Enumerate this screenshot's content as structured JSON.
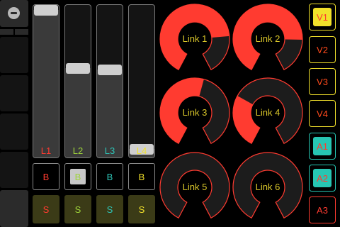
{
  "theme": {
    "red": "#ff3b30",
    "green": "#9ed33a",
    "cyan": "#2ec4b6",
    "yellow": "#f2e12b",
    "orange": "#ff4a1c",
    "teal": "#27c6b3"
  },
  "nav": {
    "icon": "toggle-knob-icon"
  },
  "faders": [
    {
      "label": "L1",
      "color": "#ff3b30",
      "level": 1.0
    },
    {
      "label": "L2",
      "color": "#9ed33a",
      "level": 0.59
    },
    {
      "label": "L3",
      "color": "#2ec4b6",
      "level": 0.58
    },
    {
      "label": "L4",
      "color": "#f2e12b",
      "level": 0.02
    }
  ],
  "bbuttons": [
    {
      "label": "B",
      "color": "#ff3b30",
      "active": false
    },
    {
      "label": "B",
      "color": "#9ed33a",
      "active": true
    },
    {
      "label": "B",
      "color": "#2ec4b6",
      "active": false
    },
    {
      "label": "B",
      "color": "#f2e12b",
      "active": false
    }
  ],
  "sbuttons": [
    {
      "label": "S",
      "color": "#ff3b30"
    },
    {
      "label": "S",
      "color": "#9ed33a"
    },
    {
      "label": "S",
      "color": "#2ec4b6"
    },
    {
      "label": "S",
      "color": "#f2e12b"
    }
  ],
  "knobs": [
    {
      "label": "Link 1",
      "value": 0.78
    },
    {
      "label": "Link 2",
      "value": 0.8
    },
    {
      "label": "Link 3",
      "value": 0.55
    },
    {
      "label": "Link 4",
      "value": 0.3
    },
    {
      "label": "Link 5",
      "value": 0.0
    },
    {
      "label": "Link 6",
      "value": 0.0
    }
  ],
  "right_buttons": [
    {
      "label": "V1",
      "active": true,
      "kind": "v"
    },
    {
      "label": "V2",
      "active": false,
      "kind": "v"
    },
    {
      "label": "V3",
      "active": false,
      "kind": "v"
    },
    {
      "label": "V4",
      "active": false,
      "kind": "v"
    },
    {
      "label": "A1",
      "active": true,
      "kind": "a"
    },
    {
      "label": "A2",
      "active": true,
      "kind": "a"
    },
    {
      "label": "A3",
      "active": false,
      "kind": "a"
    }
  ]
}
